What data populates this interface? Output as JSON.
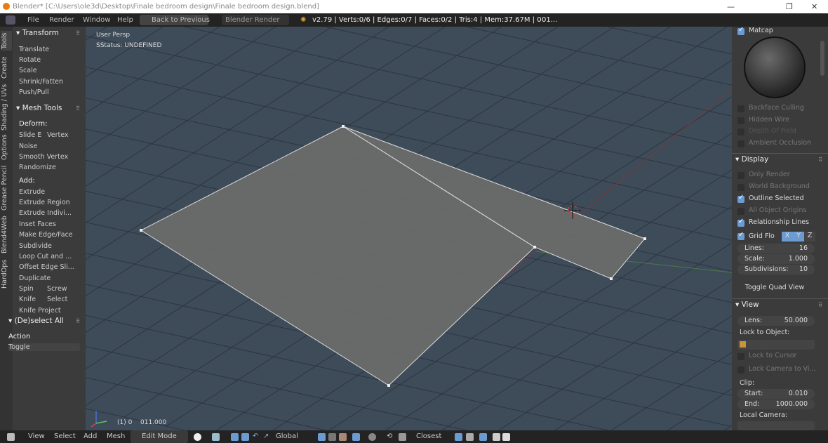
{
  "title": "Blender* [C:\\Users\\ole3d\\Desktop\\Finale bedroom design\\Finale bedroom design.blend]",
  "window_controls": [
    "—",
    "❐",
    "✕"
  ],
  "menu": {
    "items": [
      "File",
      "Render",
      "Window",
      "Help"
    ],
    "back": "Back to Previous",
    "engine": "Blender Render",
    "stats": "v2.79 | Verts:0/6 | Edges:0/7 | Faces:0/2 | Tris:4 | Mem:37.67M | 0",
    "extra": "01..."
  },
  "left_tabs": [
    "Tools",
    "Create",
    "Shading / UVs",
    "Options",
    "Grease Pencil",
    "Blend4Web",
    "HardOps"
  ],
  "transform": {
    "title": "Transform",
    "items": [
      "Translate",
      "Rotate",
      "Scale",
      "Shrink/Fatten",
      "Push/Pull"
    ]
  },
  "mesh_tools": {
    "title": "Mesh Tools",
    "deform_label": "Deform:",
    "slide_e": "Slide E",
    "vertex": "Vertex",
    "deform": [
      "Noise",
      "Smooth Vertex",
      "Randomize"
    ],
    "add_label": "Add:",
    "add": [
      "Extrude",
      "Extrude Region",
      "Extrude Indivi...",
      "Inset Faces",
      "Make Edge/Face",
      "Subdivide",
      "Loop Cut and ...",
      "Offset Edge Sli...",
      "Duplicate"
    ],
    "spin": "Spin",
    "screw": "Screw",
    "knife": "Knife",
    "select": "Select",
    "knife_project": "Knife Project"
  },
  "operator": {
    "title": "(De)select All",
    "action_label": "Action",
    "action_value": "Toggle"
  },
  "viewport": {
    "view_name": "User Persp",
    "status": "SStatus: UNDEFINED",
    "frame": "(1) 0",
    "frame2": "011.000"
  },
  "right": {
    "matcap": "Matcap",
    "shading": [
      {
        "label": "Backface Culling",
        "on": false
      },
      {
        "label": "Hidden Wire",
        "on": false
      },
      {
        "label": "Depth Of Field",
        "on": false
      },
      {
        "label": "Ambient Occlusion",
        "on": false
      }
    ],
    "display": {
      "title": "Display",
      "items": [
        {
          "label": "Only Render",
          "on": false
        },
        {
          "label": "World Background",
          "on": false
        },
        {
          "label": "Outline Selected",
          "on": true
        },
        {
          "label": "All Object Origins",
          "on": false
        },
        {
          "label": "Relationship Lines",
          "on": true
        }
      ],
      "grid_floor": "Grid Flo",
      "axes": [
        "X",
        "Y",
        "Z"
      ],
      "lines_label": "Lines:",
      "lines": "16",
      "scale_label": "Scale:",
      "scale": "1.000",
      "subdiv_label": "Subdivisions:",
      "subdiv": "10",
      "quad": "Toggle Quad View"
    },
    "view": {
      "title": "View",
      "lens_label": "Lens:",
      "lens": "50.000",
      "lock_obj": "Lock to Object:",
      "lock_cursor": "Lock to Cursor",
      "lock_camera": "Lock Camera to Vi...",
      "clip": "Clip:",
      "start_label": "Start:",
      "start": "0.010",
      "end_label": "End:",
      "end": "1000.000",
      "local_camera": "Local Camera:"
    }
  },
  "bottom": {
    "menus": [
      "View",
      "Select",
      "Add",
      "Mesh"
    ],
    "mode": "Edit Mode",
    "orientation": "Global",
    "snap": "Closest"
  },
  "colors": {
    "viewport": "#3e4b59",
    "face": "#6a6a6a",
    "accent": "#6c9bd2"
  }
}
